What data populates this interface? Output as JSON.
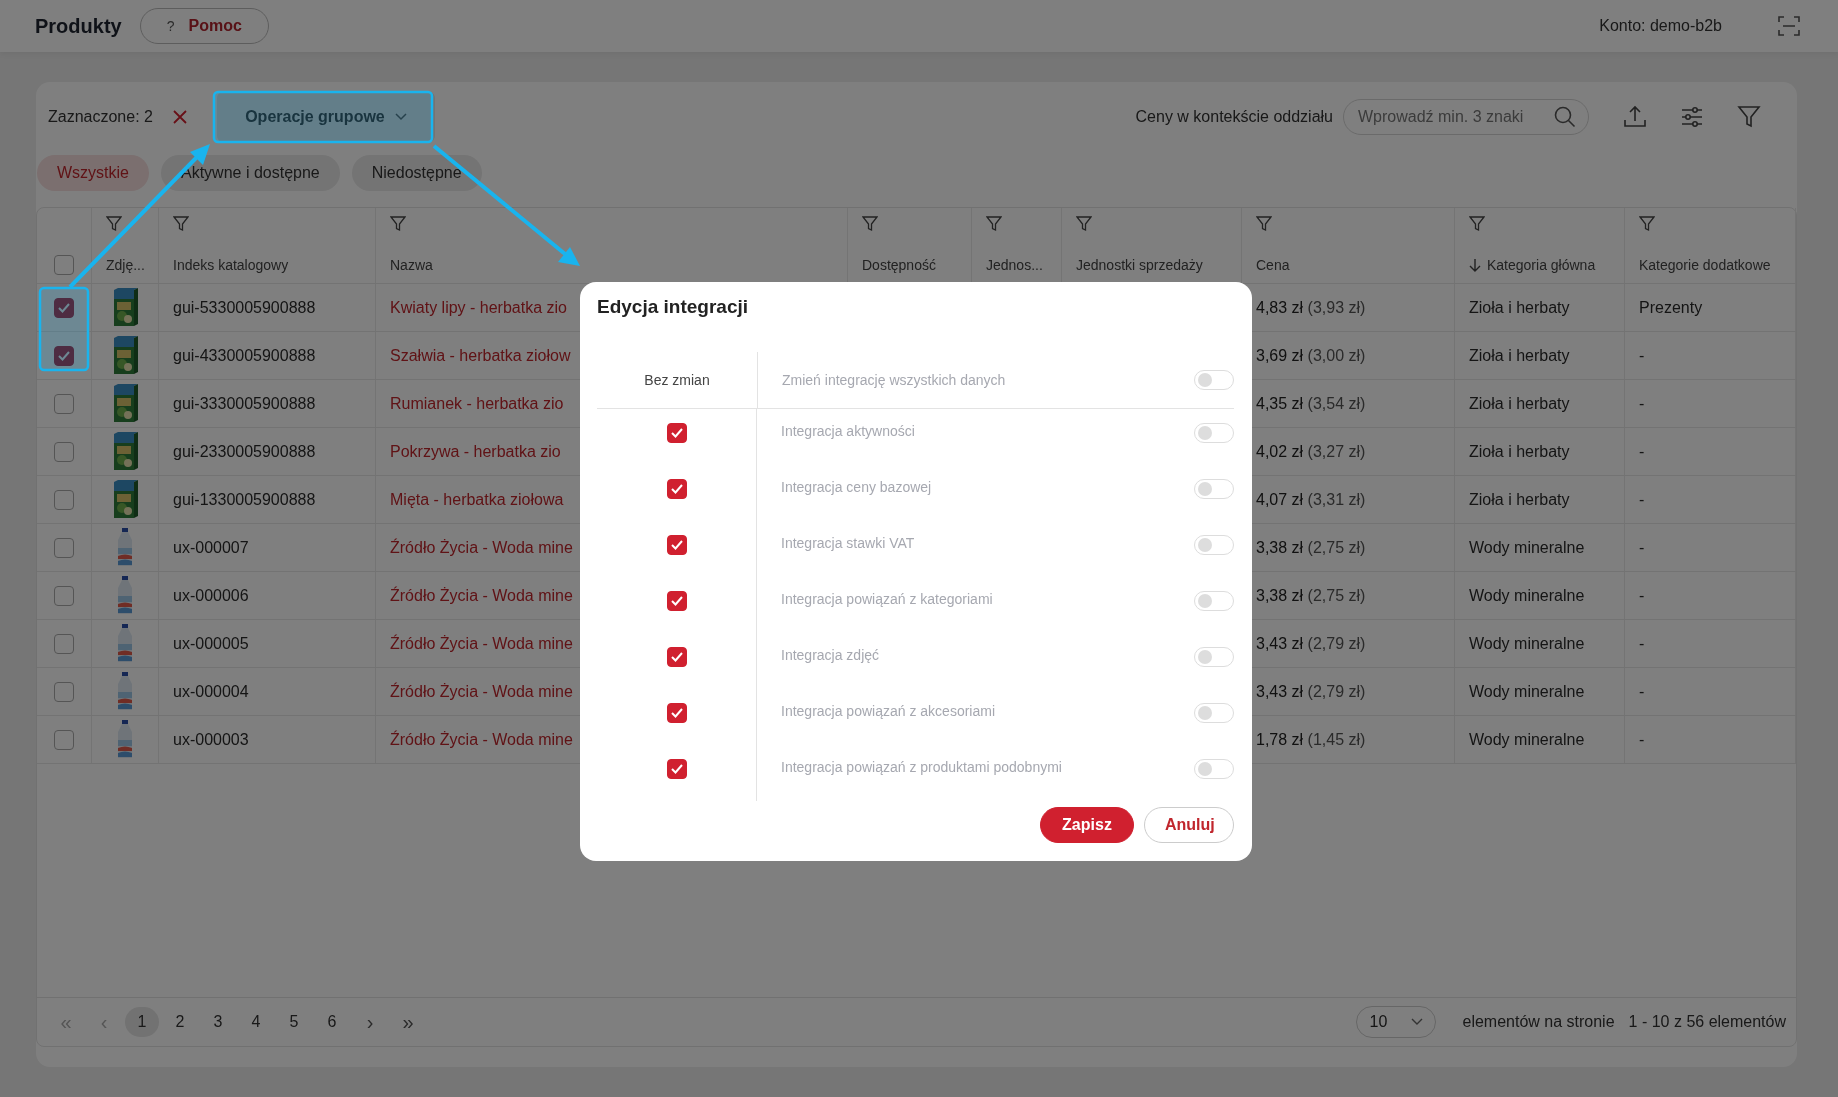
{
  "header": {
    "title": "Produkty",
    "help_button": {
      "icon": "?",
      "label": "Pomoc"
    },
    "account": "Konto: demo-b2b"
  },
  "toolbar": {
    "selection": "Zaznaczone: 2",
    "bulk_button": "Operacje grupowe",
    "price_context": "Ceny w kontekście oddziału",
    "search": {
      "placeholder": "Wprowadź min. 3 znaki"
    }
  },
  "tabs": [
    {
      "label": "Wszystkie",
      "selected": true
    },
    {
      "label": "Aktywne i dostępne",
      "selected": false
    },
    {
      "label": "Niedostępne",
      "selected": false
    }
  ],
  "table": {
    "select_all": {
      "checked": false
    },
    "columns": [
      {
        "label": "Zdję...",
        "sorted": false
      },
      {
        "label": "Indeks katalogowy",
        "sorted": false
      },
      {
        "label": "Nazwa",
        "sorted": false
      },
      {
        "label": "Dostępność",
        "sorted": false
      },
      {
        "label": "Jednos...",
        "sorted": false
      },
      {
        "label": "Jednostki sprzedaży",
        "sorted": false
      },
      {
        "label": "Cena",
        "sorted": false
      },
      {
        "label": "Kategoria główna",
        "sorted": true
      },
      {
        "label": "Kategorie dodatkowe",
        "sorted": false
      }
    ],
    "rows": [
      {
        "selected": true,
        "index": "gui-5330005900888",
        "name": "Kwiaty lipy - herbatka zio",
        "price": "4,83 zł",
        "net_price": "(3,93 zł)",
        "main_category": "Zioła i herbaty",
        "extra_categories": "Prezenty"
      },
      {
        "selected": true,
        "index": "gui-4330005900888",
        "name": "Szałwia - herbatka ziołow",
        "price": "3,69 zł",
        "net_price": "(3,00 zł)",
        "main_category": "Zioła i herbaty",
        "extra_categories": "-"
      },
      {
        "selected": false,
        "index": "gui-3330005900888",
        "name": "Rumianek - herbatka zio",
        "price": "4,35 zł",
        "net_price": "(3,54 zł)",
        "main_category": "Zioła i herbaty",
        "extra_categories": "-"
      },
      {
        "selected": false,
        "index": "gui-2330005900888",
        "name": "Pokrzywa - herbatka zio",
        "price": "4,02 zł",
        "net_price": "(3,27 zł)",
        "main_category": "Zioła i herbaty",
        "extra_categories": "-"
      },
      {
        "selected": false,
        "index": "gui-1330005900888",
        "name": "Mięta - herbatka ziołowa",
        "price": "4,07 zł",
        "net_price": "(3,31 zł)",
        "main_category": "Zioła i herbaty",
        "extra_categories": "-"
      },
      {
        "selected": false,
        "index": "ux-000007",
        "name": "Źródło Życia - Woda mine",
        "price": "3,38 zł",
        "net_price": "(2,75 zł)",
        "main_category": "Wody mineralne",
        "extra_categories": "-"
      },
      {
        "selected": false,
        "index": "ux-000006",
        "name": "Źródło Życia - Woda mine",
        "price": "3,38 zł",
        "net_price": "(2,75 zł)",
        "main_category": "Wody mineralne",
        "extra_categories": "-"
      },
      {
        "selected": false,
        "index": "ux-000005",
        "name": "Źródło Życia - Woda mine",
        "price": "3,43 zł",
        "net_price": "(2,79 zł)",
        "main_category": "Wody mineralne",
        "extra_categories": "-"
      },
      {
        "selected": false,
        "index": "ux-000004",
        "name": "Źródło Życia - Woda mine",
        "price": "3,43 zł",
        "net_price": "(2,79 zł)",
        "main_category": "Wody mineralne",
        "extra_categories": "-"
      },
      {
        "selected": false,
        "index": "ux-000003",
        "name": "Źródło Życia - Woda mine",
        "price": "1,78 zł",
        "net_price": "(1,45 zł)",
        "main_category": "Wody mineralne",
        "extra_categories": "-"
      }
    ]
  },
  "pagination": {
    "nav_prev": [
      {
        "label": "«",
        "disabled": true
      },
      {
        "label": "‹",
        "disabled": true
      }
    ],
    "pages": [
      {
        "label": "1",
        "selected": true
      },
      {
        "label": "2",
        "selected": false
      },
      {
        "label": "3",
        "selected": false
      },
      {
        "label": "4",
        "selected": false
      },
      {
        "label": "5",
        "selected": false
      },
      {
        "label": "6",
        "selected": false
      }
    ],
    "nav_next": [
      {
        "label": "›",
        "disabled": false
      },
      {
        "label": "»",
        "disabled": false
      }
    ],
    "page_size": "10",
    "page_size_label": "elementów na stronie",
    "range": "1 - 10 z 56 elementów"
  },
  "dialog": {
    "title": "Edycja integracji",
    "unchanged_label": "Bez zmian",
    "master": {
      "label": "Zmień integrację wszystkich danych",
      "on": false
    },
    "rows": [
      {
        "unchanged": true,
        "label": "Integracja aktywności",
        "on": false,
        "disabled": true
      },
      {
        "unchanged": true,
        "label": "Integracja ceny bazowej",
        "on": false,
        "disabled": true
      },
      {
        "unchanged": true,
        "label": "Integracja stawki VAT",
        "on": false,
        "disabled": true
      },
      {
        "unchanged": true,
        "label": "Integracja powiązań z kategoriami",
        "on": false,
        "disabled": true
      },
      {
        "unchanged": true,
        "label": "Integracja zdjęć",
        "on": false,
        "disabled": true
      },
      {
        "unchanged": true,
        "label": "Integracja powiązań z akcesoriami",
        "on": false,
        "disabled": true
      },
      {
        "unchanged": true,
        "label": "Integracja powiązań z produktami podobnymi",
        "on": false,
        "disabled": true
      }
    ],
    "buttons": [
      {
        "label": "Zapisz",
        "kind": "primary"
      },
      {
        "label": "Anuluj",
        "kind": "secondary"
      }
    ]
  }
}
